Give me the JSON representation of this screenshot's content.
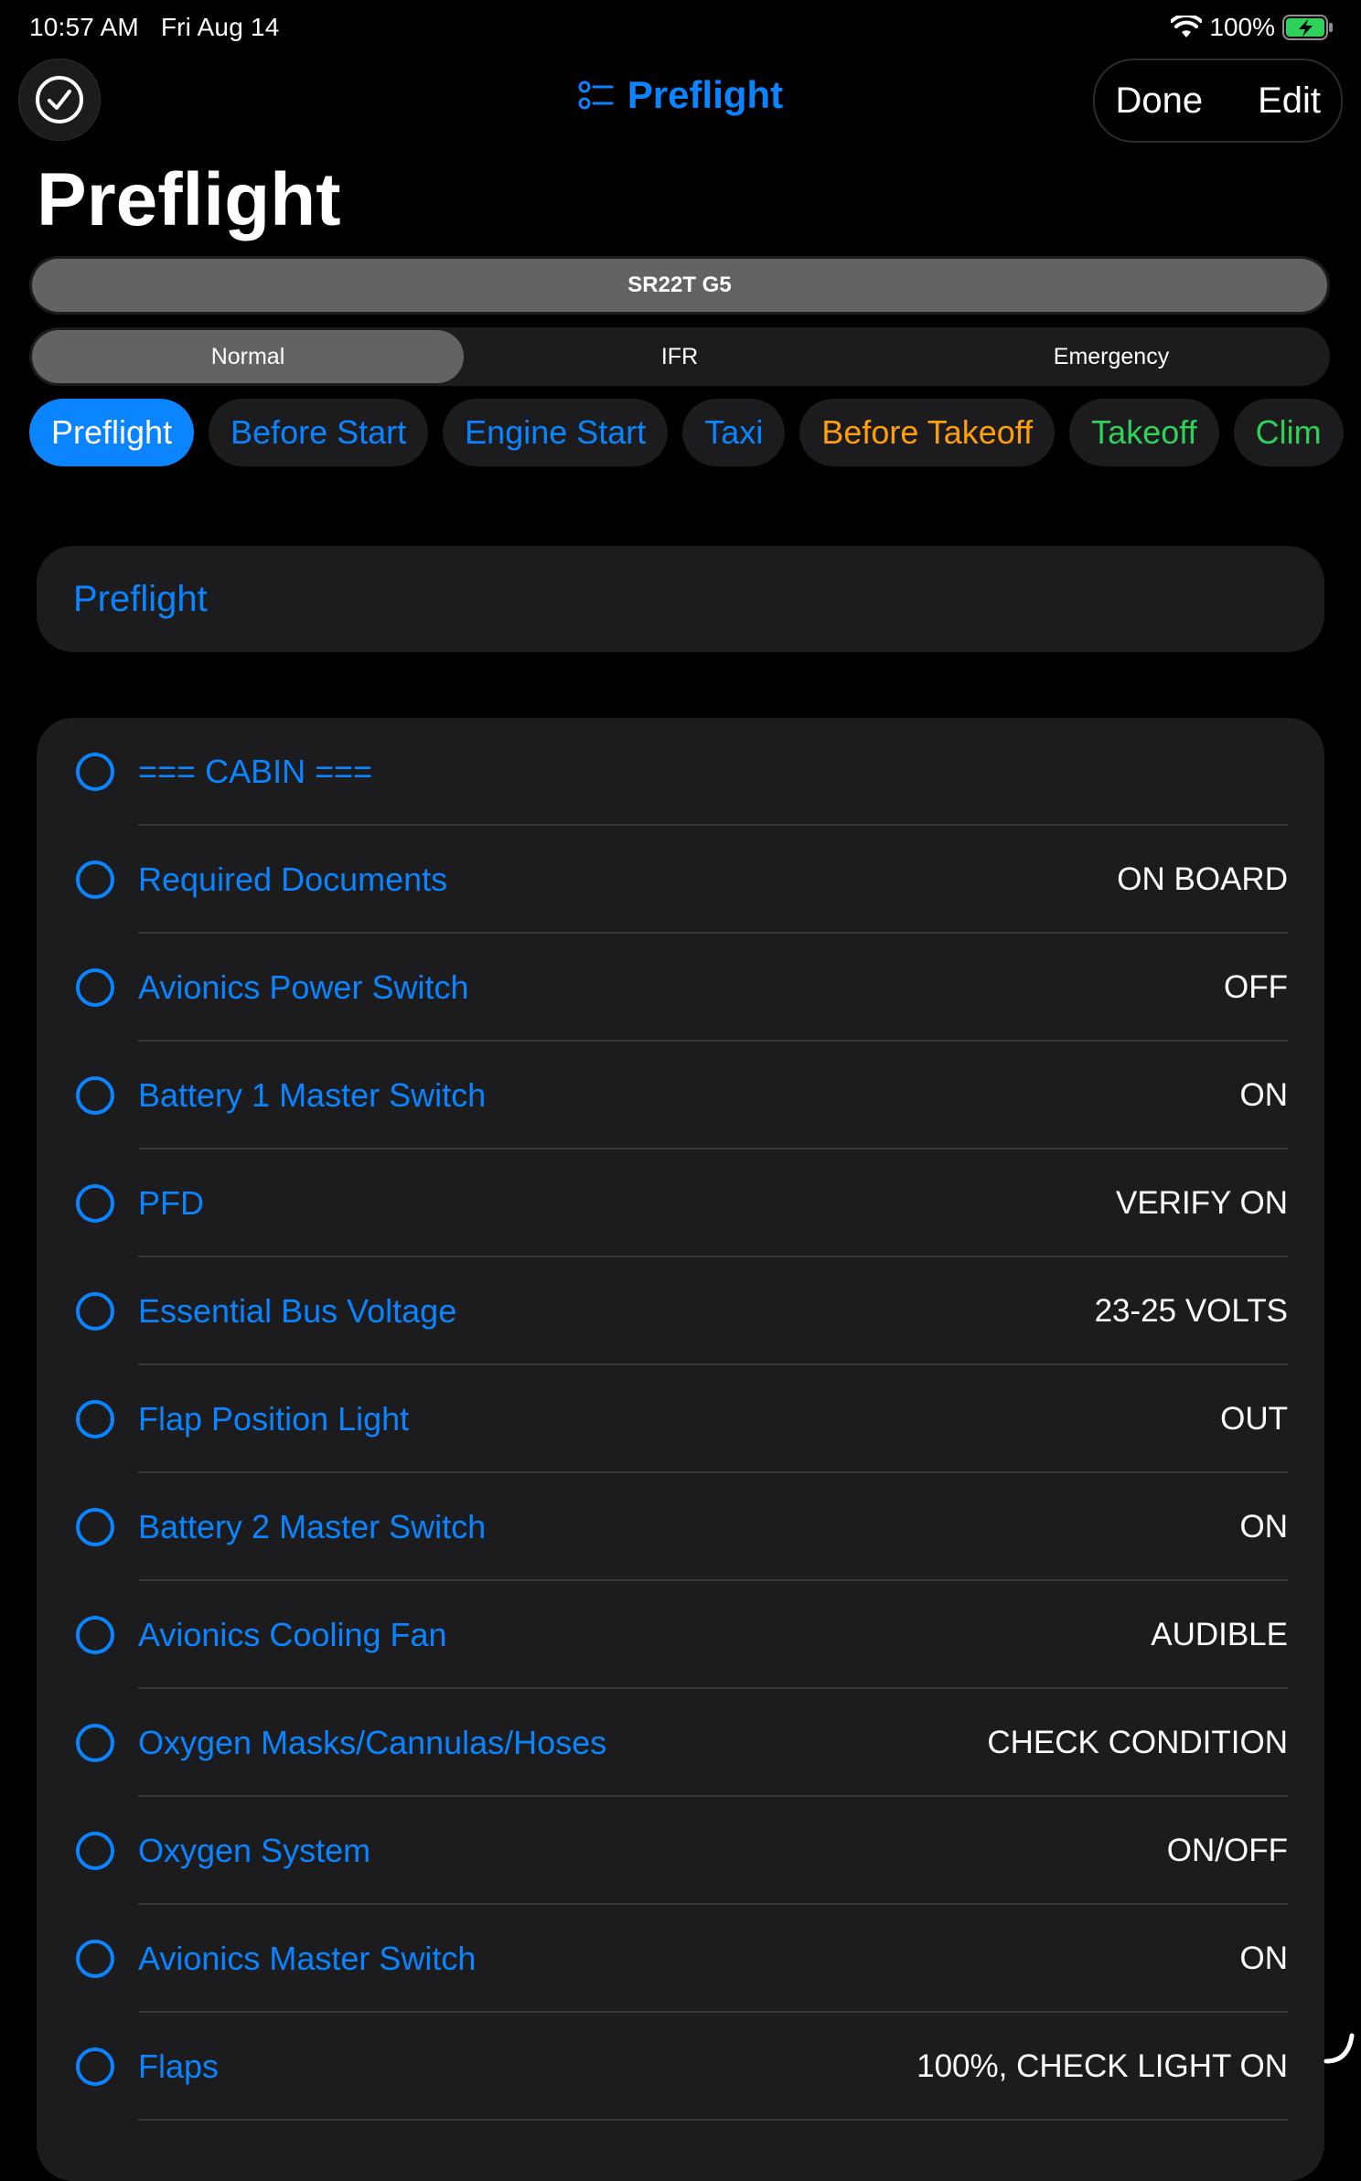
{
  "status_bar": {
    "time": "10:57 AM",
    "date": "Fri Aug 14",
    "battery_percent": "100%"
  },
  "nav": {
    "title": "Preflight",
    "done_label": "Done",
    "edit_label": "Edit"
  },
  "page_title": "Preflight",
  "aircraft_selector": {
    "selected": "SR22T G5"
  },
  "checklist_type": {
    "segments": [
      "Normal",
      "IFR",
      "Emergency"
    ],
    "selected_index": 0
  },
  "phase_chips": [
    {
      "label": "Preflight",
      "color": "#ffffff",
      "active": true
    },
    {
      "label": "Before Start",
      "color": "#0a84ff",
      "active": false
    },
    {
      "label": "Engine Start",
      "color": "#0a84ff",
      "active": false
    },
    {
      "label": "Taxi",
      "color": "#0a84ff",
      "active": false
    },
    {
      "label": "Before Takeoff",
      "color": "#ff9f0a",
      "active": false
    },
    {
      "label": "Takeoff",
      "color": "#30d158",
      "active": false
    },
    {
      "label": "Clim",
      "color": "#30d158",
      "active": false
    }
  ],
  "section_header": "Preflight",
  "checklist_items": [
    {
      "label": "=== CABIN ===",
      "value": ""
    },
    {
      "label": "Required Documents",
      "value": "ON BOARD"
    },
    {
      "label": "Avionics Power Switch",
      "value": "OFF"
    },
    {
      "label": "Battery 1 Master Switch",
      "value": "ON"
    },
    {
      "label": "PFD",
      "value": "VERIFY ON"
    },
    {
      "label": "Essential Bus Voltage",
      "value": "23-25 VOLTS"
    },
    {
      "label": "Flap Position Light",
      "value": "OUT"
    },
    {
      "label": "Battery 2 Master Switch",
      "value": "ON"
    },
    {
      "label": "Avionics Cooling Fan",
      "value": "AUDIBLE"
    },
    {
      "label": "Oxygen Masks/Cannulas/Hoses",
      "value": "CHECK CONDITION"
    },
    {
      "label": "Oxygen System",
      "value": "ON/OFF"
    },
    {
      "label": "Avionics Master Switch",
      "value": "ON"
    },
    {
      "label": "Flaps",
      "value": "100%, CHECK LIGHT ON"
    }
  ],
  "colors": {
    "accent": "#0a84ff",
    "background": "#000000",
    "card": "#1c1c1e",
    "battery_fill": "#30d158"
  }
}
